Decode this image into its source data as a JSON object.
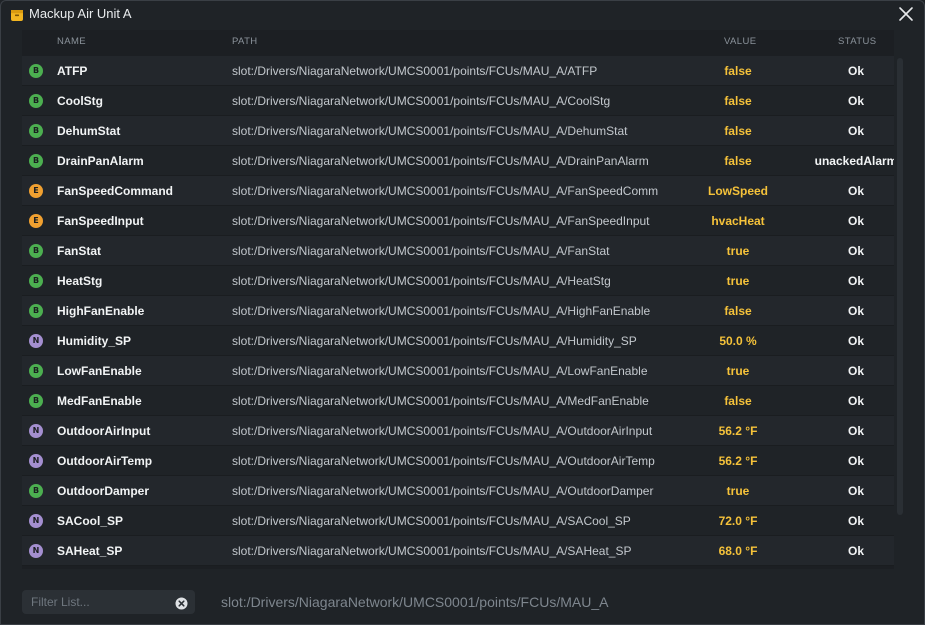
{
  "window": {
    "title": "Mackup Air Unit A",
    "icon": "box-icon",
    "close_icon": "close-icon"
  },
  "columns": {
    "name": "NAME",
    "path": "PATH",
    "value": "VALUE",
    "status": "STATUS"
  },
  "colors": {
    "boolean_badge": "#4caf50",
    "enum_badge": "#f0a030",
    "numeric_badge": "#a48fd0",
    "value_text": "#f5c23a"
  },
  "rows": [
    {
      "badge": "B",
      "name": "ATFP",
      "path": "slot:/Drivers/NiagaraNetwork/UMCS0001/points/FCUs/MAU_A/ATFP",
      "value": "false",
      "status": "Ok"
    },
    {
      "badge": "B",
      "name": "CoolStg",
      "path": "slot:/Drivers/NiagaraNetwork/UMCS0001/points/FCUs/MAU_A/CoolStg",
      "value": "false",
      "status": "Ok"
    },
    {
      "badge": "B",
      "name": "DehumStat",
      "path": "slot:/Drivers/NiagaraNetwork/UMCS0001/points/FCUs/MAU_A/DehumStat",
      "value": "false",
      "status": "Ok"
    },
    {
      "badge": "B",
      "name": "DrainPanAlarm",
      "path": "slot:/Drivers/NiagaraNetwork/UMCS0001/points/FCUs/MAU_A/DrainPanAlarm",
      "value": "false",
      "status": "unackedAlarm"
    },
    {
      "badge": "E",
      "name": "FanSpeedCommand",
      "path": "slot:/Drivers/NiagaraNetwork/UMCS0001/points/FCUs/MAU_A/FanSpeedComm",
      "value": "LowSpeed",
      "status": "Ok"
    },
    {
      "badge": "E",
      "name": "FanSpeedInput",
      "path": "slot:/Drivers/NiagaraNetwork/UMCS0001/points/FCUs/MAU_A/FanSpeedInput",
      "value": "hvacHeat",
      "status": "Ok"
    },
    {
      "badge": "B",
      "name": "FanStat",
      "path": "slot:/Drivers/NiagaraNetwork/UMCS0001/points/FCUs/MAU_A/FanStat",
      "value": "true",
      "status": "Ok"
    },
    {
      "badge": "B",
      "name": "HeatStg",
      "path": "slot:/Drivers/NiagaraNetwork/UMCS0001/points/FCUs/MAU_A/HeatStg",
      "value": "true",
      "status": "Ok"
    },
    {
      "badge": "B",
      "name": "HighFanEnable",
      "path": "slot:/Drivers/NiagaraNetwork/UMCS0001/points/FCUs/MAU_A/HighFanEnable",
      "value": "false",
      "status": "Ok"
    },
    {
      "badge": "N",
      "name": "Humidity_SP",
      "path": "slot:/Drivers/NiagaraNetwork/UMCS0001/points/FCUs/MAU_A/Humidity_SP",
      "value": "50.0 %",
      "status": "Ok"
    },
    {
      "badge": "B",
      "name": "LowFanEnable",
      "path": "slot:/Drivers/NiagaraNetwork/UMCS0001/points/FCUs/MAU_A/LowFanEnable",
      "value": "true",
      "status": "Ok"
    },
    {
      "badge": "B",
      "name": "MedFanEnable",
      "path": "slot:/Drivers/NiagaraNetwork/UMCS0001/points/FCUs/MAU_A/MedFanEnable",
      "value": "false",
      "status": "Ok"
    },
    {
      "badge": "N",
      "name": "OutdoorAirInput",
      "path": "slot:/Drivers/NiagaraNetwork/UMCS0001/points/FCUs/MAU_A/OutdoorAirInput",
      "value": "56.2 °F",
      "status": "Ok"
    },
    {
      "badge": "N",
      "name": "OutdoorAirTemp",
      "path": "slot:/Drivers/NiagaraNetwork/UMCS0001/points/FCUs/MAU_A/OutdoorAirTemp",
      "value": "56.2 °F",
      "status": "Ok"
    },
    {
      "badge": "B",
      "name": "OutdoorDamper",
      "path": "slot:/Drivers/NiagaraNetwork/UMCS0001/points/FCUs/MAU_A/OutdoorDamper",
      "value": "true",
      "status": "Ok"
    },
    {
      "badge": "N",
      "name": "SACool_SP",
      "path": "slot:/Drivers/NiagaraNetwork/UMCS0001/points/FCUs/MAU_A/SACool_SP",
      "value": "72.0 °F",
      "status": "Ok"
    },
    {
      "badge": "N",
      "name": "SAHeat_SP",
      "path": "slot:/Drivers/NiagaraNetwork/UMCS0001/points/FCUs/MAU_A/SAHeat_SP",
      "value": "68.0 °F",
      "status": "Ok"
    }
  ],
  "filter": {
    "placeholder": "Filter List...",
    "value": "",
    "clear_icon": "clear-circle-icon"
  },
  "footer": {
    "path": "slot:/Drivers/NiagaraNetwork/UMCS0001/points/FCUs/MAU_A"
  }
}
